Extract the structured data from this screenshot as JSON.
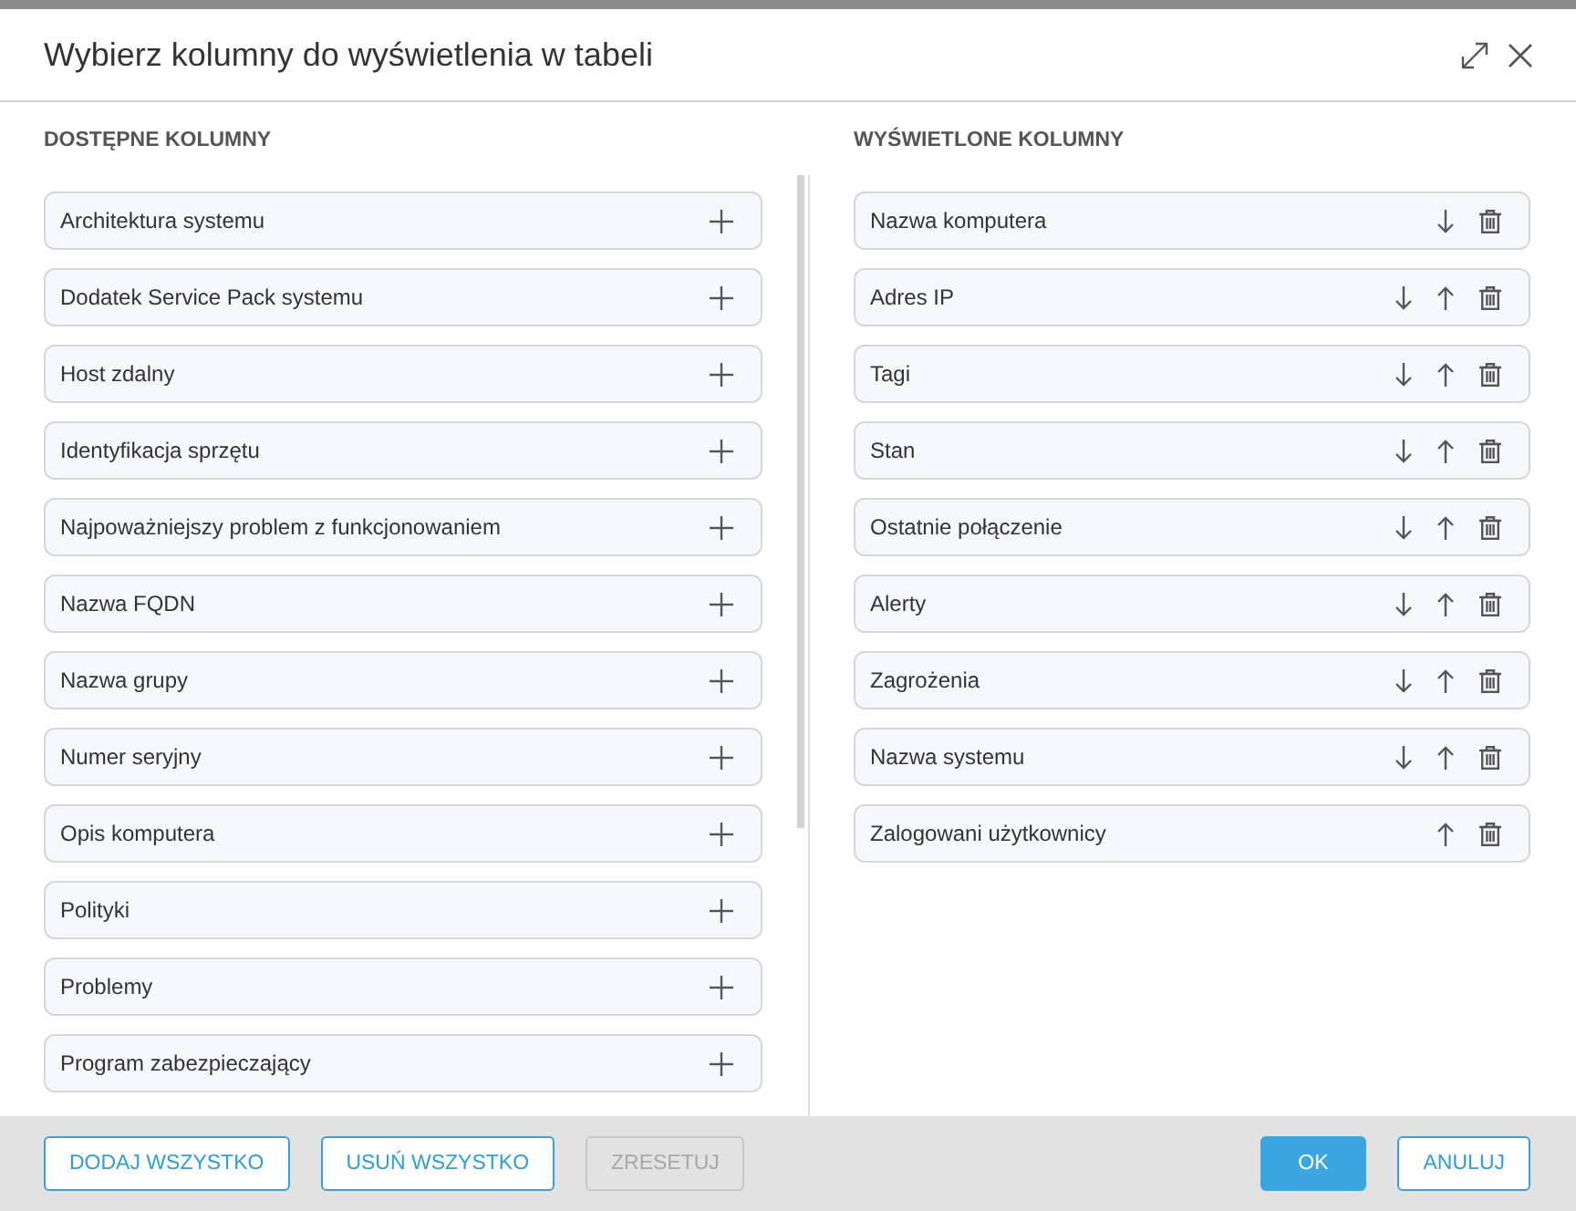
{
  "window": {
    "title": "Wybierz kolumny do wyświetlenia w tabeli"
  },
  "available": {
    "heading": "DOSTĘPNE KOLUMNY",
    "items": [
      {
        "label": "Architektura systemu"
      },
      {
        "label": "Dodatek Service Pack systemu"
      },
      {
        "label": "Host zdalny"
      },
      {
        "label": "Identyfikacja sprzętu"
      },
      {
        "label": "Najpoważniejszy problem z funkcjonowaniem"
      },
      {
        "label": "Nazwa FQDN"
      },
      {
        "label": "Nazwa grupy"
      },
      {
        "label": "Numer seryjny"
      },
      {
        "label": "Opis komputera"
      },
      {
        "label": "Polityki"
      },
      {
        "label": "Problemy"
      },
      {
        "label": "Program zabezpieczający"
      }
    ]
  },
  "displayed": {
    "heading": "WYŚWIETLONE KOLUMNY",
    "items": [
      {
        "label": "Nazwa komputera",
        "move_down": true,
        "move_up": false
      },
      {
        "label": "Adres IP",
        "move_down": true,
        "move_up": true
      },
      {
        "label": "Tagi",
        "move_down": true,
        "move_up": true
      },
      {
        "label": "Stan",
        "move_down": true,
        "move_up": true
      },
      {
        "label": "Ostatnie połączenie",
        "move_down": true,
        "move_up": true
      },
      {
        "label": "Alerty",
        "move_down": true,
        "move_up": true
      },
      {
        "label": "Zagrożenia",
        "move_down": true,
        "move_up": true
      },
      {
        "label": "Nazwa systemu",
        "move_down": true,
        "move_up": true
      },
      {
        "label": "Zalogowani użytkownicy",
        "move_down": false,
        "move_up": true
      }
    ]
  },
  "footer": {
    "left_buttons": [
      {
        "label": "DODAJ WSZYSTKO",
        "kind": "secondary",
        "disabled": false
      },
      {
        "label": "USUŃ WSZYSTKO",
        "kind": "secondary",
        "disabled": false
      },
      {
        "label": "ZRESETUJ",
        "kind": "secondary",
        "disabled": true
      }
    ],
    "right_buttons": [
      {
        "label": "OK",
        "kind": "primary",
        "disabled": false
      },
      {
        "label": "ANULUJ",
        "kind": "secondary",
        "disabled": false
      }
    ]
  }
}
